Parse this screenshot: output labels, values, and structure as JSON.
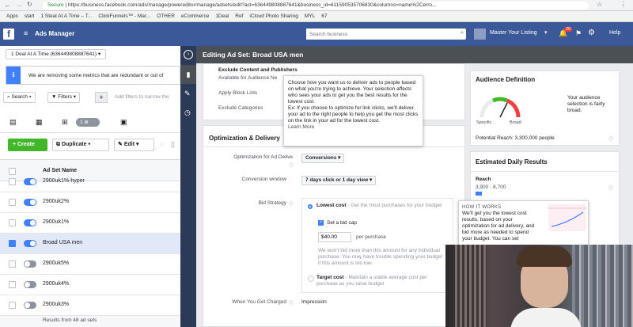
{
  "browser": {
    "secure": "Secure",
    "url": "https://business.facebook.com/ads/manage/powereditor/manage/adsets/edit?act=636449808887641&business_id=611590535706830&columns=name%2Cerro..."
  },
  "bookmarks": [
    "Apps",
    "start",
    "1 Steal At A Time – T...",
    "ClickFunnels™ - Mar...",
    "OTHER",
    "eCommerce",
    "1Deal",
    "Ref",
    "iCloud Photo Sharing",
    "MYL",
    "67"
  ],
  "topbar": {
    "title": "Ads Manager",
    "search_placeholder": "Search business",
    "account": "Master Your Listing",
    "notif": "20",
    "help": "Help"
  },
  "left": {
    "account_label": "1 Deal At A Time (636449808887641)",
    "notice": "We are removing some metrics that are redundant or out of",
    "search": "Search",
    "filters": "Filters",
    "add_filters": "Add filters to narrow the",
    "count": "1",
    "create": "Create",
    "duplicate": "Duplicate",
    "edit": "Edit",
    "col_header": "Ad Set Name",
    "rows": [
      {
        "name": "2900uk1%-hyper",
        "on": true,
        "sel": false
      },
      {
        "name": "2900uk2%",
        "on": true,
        "sel": false
      },
      {
        "name": "2900uk1%",
        "on": true,
        "sel": false
      },
      {
        "name": "Broad USA men",
        "on": true,
        "sel": true
      },
      {
        "name": "2900uk5%",
        "on": false,
        "sel": false
      },
      {
        "name": "2900uk4%",
        "on": false,
        "sel": false
      },
      {
        "name": "2900uk3%",
        "on": false,
        "sel": false
      }
    ],
    "footer": "Results from 48 ad sets"
  },
  "panel": {
    "title": "Editing Ad Set: Broad USA men",
    "exclude": {
      "title": "Exclude Content and Publishers",
      "available": "Available for Audience Ne",
      "block": "Apply Block Lists",
      "cats": "Exclude Categories"
    },
    "tooltip": "Choose how you want us to deliver ads to people based on what you're trying to achieve. Your selection affects who sees your ads to get you the best results for the lowest cost.\nEx: If you choose to optimize for link clicks, we'll deliver your ad to the right people to help you get the most clicks on the link in your ad for the lowest cost.",
    "learn_more": "Learn More",
    "opt": {
      "section": "Optimization & Delivery",
      "for_label": "Optimization for Ad Delive",
      "for_value": "Conversions",
      "window_label": "Conversion window",
      "window_value": "7 days click or 1 day view",
      "bid_label": "Bid Strategy",
      "lowest": "Lowest cost",
      "lowest_desc": "- Get the most purchases for your budget",
      "bidcap": "Set a bid cap",
      "bid_amount": "$40.00",
      "per": "per purchase",
      "warn": "We won't bid more than this amount for any individual purchase. You may have trouble spending your budget if this amount is too low.",
      "target": "Target cost",
      "target_desc": "- Maintain a stable average cost per purchase as you raise budget",
      "charged_label": "When You Get Charged",
      "charged_value": "Impression"
    },
    "how": {
      "title": "HOW IT WORKS",
      "text": "We'll get you the lowest cost results, based on your optimization for ad delivery, and bid more as needed to spend your budget. You can set"
    },
    "audience": {
      "title": "Audience Definition",
      "note": "Your audience selection is fairly broad.",
      "specific": "Specific",
      "broad": "Broad",
      "reach": "Potential Reach: 3,300,000 people"
    },
    "daily": {
      "title": "Estimated Daily Results",
      "reach": "Reach",
      "range": "3,900 - 8,700"
    }
  }
}
